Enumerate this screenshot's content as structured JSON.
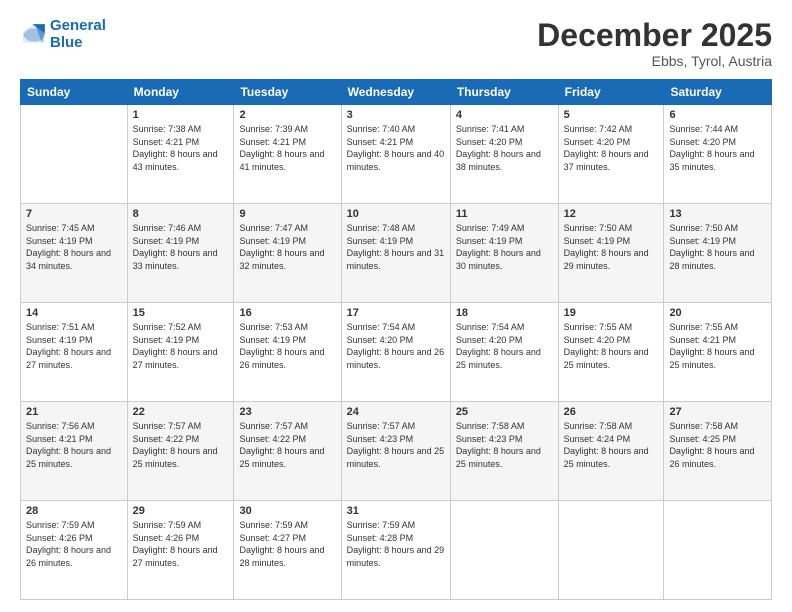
{
  "header": {
    "logo_line1": "General",
    "logo_line2": "Blue",
    "month": "December 2025",
    "location": "Ebbs, Tyrol, Austria"
  },
  "weekdays": [
    "Sunday",
    "Monday",
    "Tuesday",
    "Wednesday",
    "Thursday",
    "Friday",
    "Saturday"
  ],
  "weeks": [
    [
      {
        "day": "",
        "sunrise": "",
        "sunset": "",
        "daylight": ""
      },
      {
        "day": "1",
        "sunrise": "7:38 AM",
        "sunset": "4:21 PM",
        "daylight": "8 hours and 43 minutes."
      },
      {
        "day": "2",
        "sunrise": "7:39 AM",
        "sunset": "4:21 PM",
        "daylight": "8 hours and 41 minutes."
      },
      {
        "day": "3",
        "sunrise": "7:40 AM",
        "sunset": "4:21 PM",
        "daylight": "8 hours and 40 minutes."
      },
      {
        "day": "4",
        "sunrise": "7:41 AM",
        "sunset": "4:20 PM",
        "daylight": "8 hours and 38 minutes."
      },
      {
        "day": "5",
        "sunrise": "7:42 AM",
        "sunset": "4:20 PM",
        "daylight": "8 hours and 37 minutes."
      },
      {
        "day": "6",
        "sunrise": "7:44 AM",
        "sunset": "4:20 PM",
        "daylight": "8 hours and 35 minutes."
      }
    ],
    [
      {
        "day": "7",
        "sunrise": "7:45 AM",
        "sunset": "4:19 PM",
        "daylight": "8 hours and 34 minutes."
      },
      {
        "day": "8",
        "sunrise": "7:46 AM",
        "sunset": "4:19 PM",
        "daylight": "8 hours and 33 minutes."
      },
      {
        "day": "9",
        "sunrise": "7:47 AM",
        "sunset": "4:19 PM",
        "daylight": "8 hours and 32 minutes."
      },
      {
        "day": "10",
        "sunrise": "7:48 AM",
        "sunset": "4:19 PM",
        "daylight": "8 hours and 31 minutes."
      },
      {
        "day": "11",
        "sunrise": "7:49 AM",
        "sunset": "4:19 PM",
        "daylight": "8 hours and 30 minutes."
      },
      {
        "day": "12",
        "sunrise": "7:50 AM",
        "sunset": "4:19 PM",
        "daylight": "8 hours and 29 minutes."
      },
      {
        "day": "13",
        "sunrise": "7:50 AM",
        "sunset": "4:19 PM",
        "daylight": "8 hours and 28 minutes."
      }
    ],
    [
      {
        "day": "14",
        "sunrise": "7:51 AM",
        "sunset": "4:19 PM",
        "daylight": "8 hours and 27 minutes."
      },
      {
        "day": "15",
        "sunrise": "7:52 AM",
        "sunset": "4:19 PM",
        "daylight": "8 hours and 27 minutes."
      },
      {
        "day": "16",
        "sunrise": "7:53 AM",
        "sunset": "4:19 PM",
        "daylight": "8 hours and 26 minutes."
      },
      {
        "day": "17",
        "sunrise": "7:54 AM",
        "sunset": "4:20 PM",
        "daylight": "8 hours and 26 minutes."
      },
      {
        "day": "18",
        "sunrise": "7:54 AM",
        "sunset": "4:20 PM",
        "daylight": "8 hours and 25 minutes."
      },
      {
        "day": "19",
        "sunrise": "7:55 AM",
        "sunset": "4:20 PM",
        "daylight": "8 hours and 25 minutes."
      },
      {
        "day": "20",
        "sunrise": "7:55 AM",
        "sunset": "4:21 PM",
        "daylight": "8 hours and 25 minutes."
      }
    ],
    [
      {
        "day": "21",
        "sunrise": "7:56 AM",
        "sunset": "4:21 PM",
        "daylight": "8 hours and 25 minutes."
      },
      {
        "day": "22",
        "sunrise": "7:57 AM",
        "sunset": "4:22 PM",
        "daylight": "8 hours and 25 minutes."
      },
      {
        "day": "23",
        "sunrise": "7:57 AM",
        "sunset": "4:22 PM",
        "daylight": "8 hours and 25 minutes."
      },
      {
        "day": "24",
        "sunrise": "7:57 AM",
        "sunset": "4:23 PM",
        "daylight": "8 hours and 25 minutes."
      },
      {
        "day": "25",
        "sunrise": "7:58 AM",
        "sunset": "4:23 PM",
        "daylight": "8 hours and 25 minutes."
      },
      {
        "day": "26",
        "sunrise": "7:58 AM",
        "sunset": "4:24 PM",
        "daylight": "8 hours and 25 minutes."
      },
      {
        "day": "27",
        "sunrise": "7:58 AM",
        "sunset": "4:25 PM",
        "daylight": "8 hours and 26 minutes."
      }
    ],
    [
      {
        "day": "28",
        "sunrise": "7:59 AM",
        "sunset": "4:26 PM",
        "daylight": "8 hours and 26 minutes."
      },
      {
        "day": "29",
        "sunrise": "7:59 AM",
        "sunset": "4:26 PM",
        "daylight": "8 hours and 27 minutes."
      },
      {
        "day": "30",
        "sunrise": "7:59 AM",
        "sunset": "4:27 PM",
        "daylight": "8 hours and 28 minutes."
      },
      {
        "day": "31",
        "sunrise": "7:59 AM",
        "sunset": "4:28 PM",
        "daylight": "8 hours and 29 minutes."
      },
      {
        "day": "",
        "sunrise": "",
        "sunset": "",
        "daylight": ""
      },
      {
        "day": "",
        "sunrise": "",
        "sunset": "",
        "daylight": ""
      },
      {
        "day": "",
        "sunrise": "",
        "sunset": "",
        "daylight": ""
      }
    ]
  ],
  "labels": {
    "sunrise": "Sunrise:",
    "sunset": "Sunset:",
    "daylight": "Daylight:"
  }
}
